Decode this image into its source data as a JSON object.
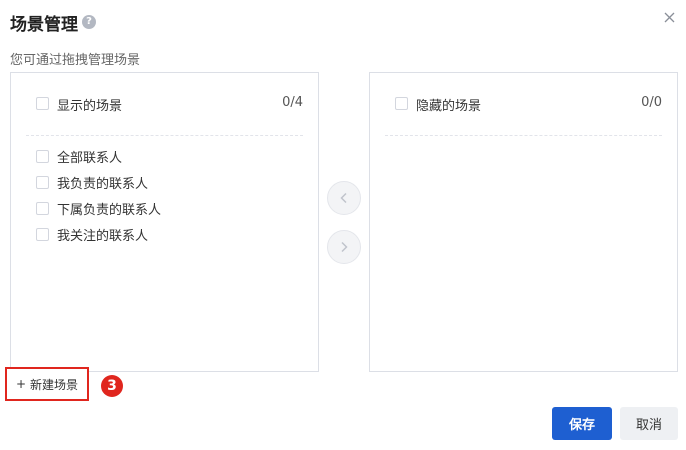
{
  "dialog": {
    "title": "场景管理",
    "help_icon": "question-circle-icon",
    "close_icon": "close-icon",
    "subtitle": "您可通过拖拽管理场景"
  },
  "shown_panel": {
    "header_label": "显示的场景",
    "count": "0/4",
    "items": [
      {
        "label": "全部联系人",
        "checked": false
      },
      {
        "label": "我负责的联系人",
        "checked": false
      },
      {
        "label": "下属负责的联系人",
        "checked": false
      },
      {
        "label": "我关注的联系人",
        "checked": false
      }
    ]
  },
  "hidden_panel": {
    "header_label": "隐藏的场景",
    "count": "0/0",
    "items": []
  },
  "transfer": {
    "move_left_icon": "chevron-left-icon",
    "move_right_icon": "chevron-right-icon"
  },
  "footer": {
    "new_scene_label": "新建场景",
    "new_scene_plus": "+",
    "step_badge": "3",
    "save_label": "保存",
    "cancel_label": "取消"
  },
  "colors": {
    "primary": "#1e5fd1",
    "highlight": "#e0261e",
    "border": "#dcdfe6"
  }
}
